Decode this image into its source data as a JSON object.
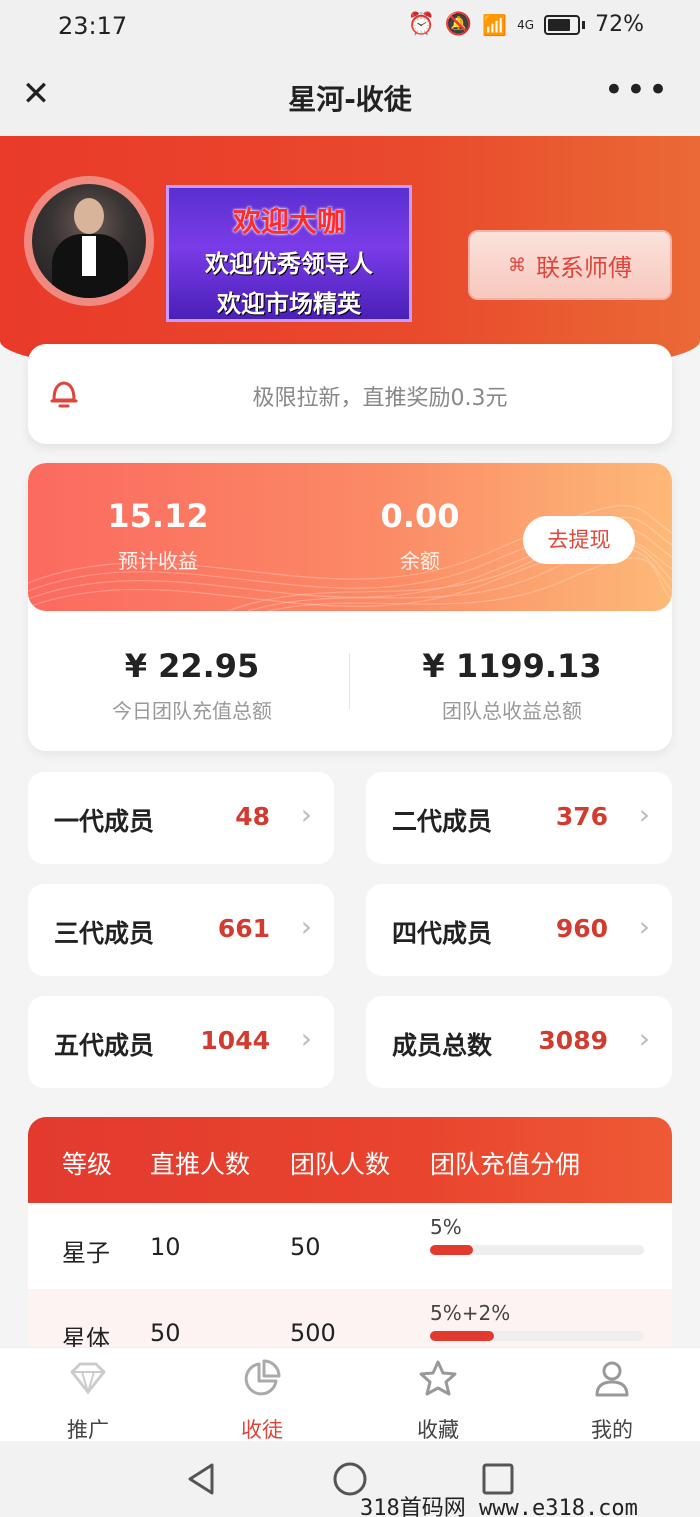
{
  "status_bar": {
    "time": "23:17",
    "network": "4G",
    "battery": "72%"
  },
  "nav": {
    "title": "星河-收徒"
  },
  "banner": {
    "line1": "欢迎大咖",
    "line2": "欢迎优秀领导人",
    "line3": "欢迎市场精英"
  },
  "contact_button": {
    "label": "联系师傅"
  },
  "notice": {
    "text": "极限拉新，直推奖励0.3元"
  },
  "earnings": {
    "estimated_value": "15.12",
    "estimated_label": "预计收益",
    "balance_value": "0.00",
    "balance_label": "余额",
    "withdraw_label": "去提现",
    "today_recharge_value": "¥ 22.95",
    "today_recharge_label": "今日团队充值总额",
    "team_total_value": "¥ 1199.13",
    "team_total_label": "团队总收益总额"
  },
  "members": [
    {
      "label": "一代成员",
      "count": "48"
    },
    {
      "label": "二代成员",
      "count": "376"
    },
    {
      "label": "三代成员",
      "count": "661"
    },
    {
      "label": "四代成员",
      "count": "960"
    },
    {
      "label": "五代成员",
      "count": "1044"
    },
    {
      "label": "成员总数",
      "count": "3089"
    }
  ],
  "level_table": {
    "headers": [
      "等级",
      "直推人数",
      "团队人数",
      "团队充值分佣"
    ],
    "rows": [
      {
        "level": "星子",
        "direct": "10",
        "team": "50",
        "commission": "5%",
        "bar_fill": 0.2
      },
      {
        "level": "星体",
        "direct": "50",
        "team": "500",
        "commission": "5%+2%",
        "bar_fill": 0.3
      }
    ]
  },
  "tabs": [
    {
      "label": "推广",
      "icon": "diamond-icon",
      "active": false
    },
    {
      "label": "收徒",
      "icon": "pie-chart-icon",
      "active": true
    },
    {
      "label": "收藏",
      "icon": "star-icon",
      "active": false
    },
    {
      "label": "我的",
      "icon": "user-icon",
      "active": false
    }
  ],
  "watermark": "318首码网  www.e318.com",
  "colors": {
    "brand_red": "#e23a2f",
    "accent_text": "#d23b2f"
  }
}
